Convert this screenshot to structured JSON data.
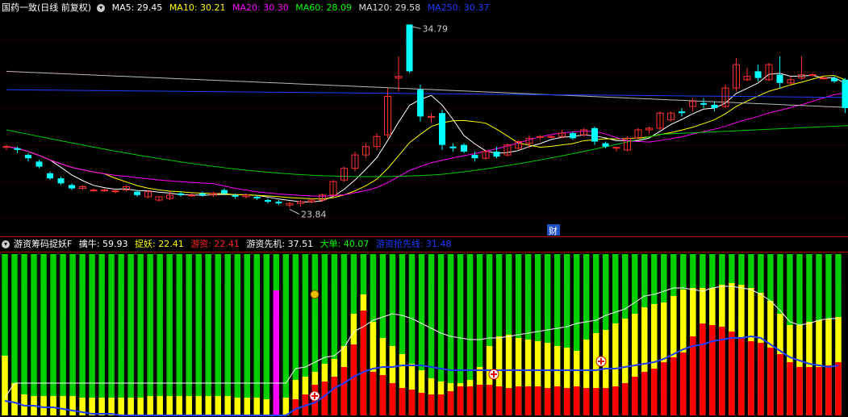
{
  "header": {
    "title": "国药一致(日线 前复权)",
    "ma": [
      {
        "label": "MA5: 29.45",
        "color": "#ffffff"
      },
      {
        "label": "MA10: 30.21",
        "color": "#ffff00"
      },
      {
        "label": "MA20: 30.30",
        "color": "#ff00ff"
      },
      {
        "label": "MA60: 28.09",
        "color": "#00ff00"
      },
      {
        "label": "MA120: 29.58",
        "color": "#dddddd"
      },
      {
        "label": "MA250: 30.37",
        "color": "#1e3cff"
      }
    ]
  },
  "price_annotations": {
    "high": "34.79",
    "low": "23.84",
    "finance_badge": "财"
  },
  "indicator_header": {
    "title": "游资筹码捉妖F",
    "values": [
      {
        "label": "擒牛: 59.93",
        "color": "#ffffff"
      },
      {
        "label": "捉妖: 22.41",
        "color": "#ffff00"
      },
      {
        "label": "游资: 22.41",
        "color": "#ff2020"
      },
      {
        "label": "游资先机: 37.51",
        "color": "#ffffff"
      },
      {
        "label": "大单: 40.07",
        "color": "#00ff00"
      },
      {
        "label": "游资抢先线: 31.48",
        "color": "#1e3cff"
      }
    ]
  },
  "colors": {
    "up": "#ff3030",
    "down": "#00ffff",
    "green_bar": "#00d000",
    "yellow": "#ffff00",
    "red": "#ff0000",
    "magenta": "#ff00ff",
    "blue": "#1e3cff"
  },
  "chart_data": {
    "type": "candlestick",
    "candles": [
      [
        27.5,
        27.6,
        27.3,
        27.5
      ],
      [
        27.4,
        27.5,
        27.1,
        27.3
      ],
      [
        27.0,
        27.1,
        26.6,
        26.8
      ],
      [
        26.6,
        26.7,
        26.2,
        26.3
      ],
      [
        25.9,
        26.0,
        25.5,
        25.6
      ],
      [
        25.6,
        25.7,
        25.2,
        25.3
      ],
      [
        25.2,
        25.3,
        24.9,
        25.0
      ],
      [
        25.0,
        25.2,
        24.9,
        25.1
      ],
      [
        24.9,
        25.0,
        24.8,
        24.9
      ],
      [
        24.9,
        25.0,
        24.8,
        24.9
      ],
      [
        24.8,
        24.9,
        24.7,
        24.85
      ],
      [
        24.9,
        25.2,
        24.8,
        25.1
      ],
      [
        24.8,
        24.9,
        24.5,
        24.6
      ],
      [
        24.5,
        24.9,
        24.4,
        24.8
      ],
      [
        24.3,
        24.5,
        24.2,
        24.5
      ],
      [
        24.4,
        24.8,
        24.3,
        24.6
      ],
      [
        24.7,
        24.8,
        24.5,
        24.6
      ],
      [
        24.6,
        24.7,
        24.5,
        24.6
      ],
      [
        24.7,
        24.8,
        24.5,
        24.6
      ],
      [
        24.6,
        24.8,
        24.5,
        24.7
      ],
      [
        24.9,
        25.0,
        24.6,
        24.7
      ],
      [
        24.6,
        24.7,
        24.4,
        24.5
      ],
      [
        24.5,
        24.7,
        24.4,
        24.6
      ],
      [
        24.5,
        24.6,
        24.3,
        24.4
      ],
      [
        24.3,
        24.4,
        24.1,
        24.2
      ],
      [
        24.2,
        24.3,
        24.0,
        24.1
      ],
      [
        24.0,
        24.2,
        23.84,
        24.1
      ],
      [
        24.1,
        24.3,
        23.9,
        24.2
      ],
      [
        24.2,
        24.4,
        24.1,
        24.3
      ],
      [
        24.3,
        24.7,
        24.2,
        24.6
      ],
      [
        24.6,
        25.5,
        24.5,
        25.4
      ],
      [
        25.5,
        26.3,
        25.4,
        26.2
      ],
      [
        26.2,
        27.2,
        26.0,
        27.0
      ],
      [
        27.0,
        27.7,
        26.8,
        27.5
      ],
      [
        27.5,
        28.3,
        27.3,
        28.1
      ],
      [
        28.2,
        31.0,
        28.0,
        30.5
      ],
      [
        31.6,
        32.9,
        30.8,
        31.7
      ],
      [
        34.8,
        34.79,
        31.9,
        32.0
      ],
      [
        30.9,
        31.2,
        29.0,
        29.3
      ],
      [
        29.3,
        29.5,
        28.9,
        29.3
      ],
      [
        29.5,
        29.7,
        27.3,
        27.6
      ],
      [
        27.5,
        27.7,
        27.2,
        27.4
      ],
      [
        27.6,
        27.7,
        27.1,
        27.2
      ],
      [
        27.0,
        27.2,
        26.6,
        26.8
      ],
      [
        26.8,
        27.3,
        26.7,
        27.2
      ],
      [
        27.2,
        27.5,
        26.8,
        26.9
      ],
      [
        27.0,
        27.7,
        26.9,
        27.6
      ],
      [
        27.4,
        27.9,
        27.3,
        27.8
      ],
      [
        27.7,
        28.2,
        27.4,
        28.0
      ],
      [
        28.1,
        28.2,
        27.9,
        28.1
      ],
      [
        28.1,
        28.2,
        28.0,
        28.1
      ],
      [
        28.1,
        28.5,
        28.0,
        28.3
      ],
      [
        28.3,
        28.4,
        27.9,
        28.0
      ],
      [
        28.2,
        28.6,
        28.1,
        28.5
      ],
      [
        28.6,
        28.7,
        27.6,
        27.8
      ],
      [
        27.7,
        27.8,
        27.4,
        27.5
      ],
      [
        27.4,
        27.5,
        27.2,
        27.45
      ],
      [
        27.3,
        28.1,
        27.2,
        28.0
      ],
      [
        28.0,
        28.6,
        27.9,
        28.5
      ],
      [
        28.5,
        28.7,
        28.3,
        28.6
      ],
      [
        28.6,
        29.6,
        28.5,
        29.5
      ],
      [
        29.1,
        29.6,
        29.0,
        29.5
      ],
      [
        29.6,
        29.8,
        29.3,
        29.5
      ],
      [
        29.9,
        30.4,
        29.6,
        30.2
      ],
      [
        30.1,
        30.4,
        29.8,
        30.0
      ],
      [
        30.0,
        30.2,
        29.6,
        29.8
      ],
      [
        29.9,
        31.2,
        29.8,
        31.0
      ],
      [
        31.0,
        32.8,
        30.8,
        32.4
      ],
      [
        31.5,
        32.2,
        31.4,
        31.7
      ],
      [
        32.0,
        32.4,
        31.4,
        31.6
      ],
      [
        31.5,
        32.5,
        31.4,
        32.4
      ],
      [
        31.8,
        32.9,
        31.0,
        31.3
      ],
      [
        31.3,
        31.7,
        31.2,
        31.5
      ],
      [
        31.6,
        32.9,
        31.5,
        31.8
      ],
      [
        31.8,
        31.9,
        31.7,
        31.8
      ],
      [
        31.6,
        31.7,
        31.5,
        31.6
      ],
      [
        31.6,
        31.7,
        31.3,
        31.4
      ],
      [
        31.5,
        31.6,
        29.5,
        29.8
      ],
      [
        29.6,
        29.7,
        29.2,
        29.4
      ],
      [
        29.3,
        29.4,
        29.1,
        29.2
      ],
      [
        29.1,
        29.4,
        29.0,
        29.3
      ],
      [
        29.2,
        29.5,
        29.1,
        29.4
      ],
      [
        29.4,
        29.6,
        29.3,
        29.4
      ],
      [
        29.4,
        29.5,
        29.3,
        29.4
      ],
      [
        29.4,
        29.6,
        29.3,
        29.5
      ],
      [
        29.6,
        29.9,
        29.4,
        29.5
      ]
    ],
    "indicator": {
      "top_line": [
        11,
        20,
        20,
        20,
        20,
        20,
        20,
        20,
        20,
        20,
        20,
        20,
        20,
        20,
        20,
        20,
        20,
        20,
        20,
        20,
        20,
        20,
        20,
        20,
        20,
        20,
        20,
        20,
        20,
        20,
        29,
        30,
        33,
        36,
        37,
        42,
        52,
        55,
        59,
        61,
        63,
        62,
        60,
        57,
        54,
        51,
        49,
        48,
        47,
        47,
        48,
        48,
        49,
        50,
        51,
        52,
        53,
        54,
        55,
        57,
        58,
        59,
        62,
        64,
        66,
        70,
        74,
        75,
        77,
        79,
        79,
        78,
        77,
        79,
        80,
        80,
        79,
        78,
        75,
        71,
        65,
        58,
        56,
        57,
        59,
        60,
        60
      ],
      "yellow_top": [
        37,
        20,
        13,
        12,
        12,
        12,
        12,
        12,
        11,
        11,
        11,
        11,
        11,
        11,
        11,
        12,
        12,
        12,
        12,
        12,
        12,
        12,
        12,
        12,
        11,
        11,
        11,
        10,
        10,
        11,
        22,
        24,
        27,
        32,
        35,
        43,
        63,
        75,
        58,
        48,
        43,
        38,
        32,
        28,
        23,
        21,
        20,
        20,
        22,
        30,
        43,
        49,
        50,
        48,
        47,
        46,
        45,
        43,
        42,
        40,
        47,
        51,
        53,
        57,
        60,
        63,
        67,
        69,
        70,
        74,
        78,
        79,
        79,
        79,
        81,
        82,
        81,
        79,
        76,
        71,
        63,
        56,
        56,
        58,
        59,
        60,
        61
      ],
      "red_top": [
        0,
        0,
        0,
        0,
        0,
        0,
        0,
        0,
        0,
        0,
        0,
        0,
        0,
        0,
        0,
        0,
        0,
        0,
        0,
        0,
        0,
        0,
        0,
        0,
        0,
        0,
        0,
        0,
        0,
        0,
        10,
        13,
        19,
        21,
        24,
        30,
        44,
        65,
        27,
        25,
        20,
        17,
        16,
        14,
        13,
        13,
        15,
        18,
        18,
        19,
        19,
        18,
        17,
        18,
        18,
        18,
        17,
        18,
        17,
        18,
        17,
        17,
        17,
        18,
        20,
        24,
        27,
        29,
        33,
        36,
        39,
        49,
        57,
        56,
        55,
        52,
        48,
        46,
        45,
        42,
        38,
        33,
        30,
        30,
        30,
        31,
        33
      ],
      "blue": [
        9,
        8,
        6,
        6,
        5,
        5,
        4,
        3,
        2,
        1,
        1,
        1,
        0,
        0,
        0,
        0,
        0,
        0,
        0,
        0,
        0,
        0,
        0,
        0,
        0,
        0,
        0,
        0,
        0,
        0,
        4,
        6,
        8,
        12,
        17,
        20,
        24,
        27,
        29,
        30,
        30,
        31,
        31,
        31,
        30,
        29,
        28,
        28,
        28,
        28,
        28,
        28,
        28,
        28,
        28,
        28,
        28,
        28,
        28,
        28,
        28,
        28,
        29,
        29,
        30,
        31,
        32,
        33,
        35,
        38,
        41,
        43,
        44,
        46,
        47,
        48,
        48,
        49,
        48,
        44,
        40,
        36,
        34,
        32,
        31,
        30,
        31
      ]
    },
    "y_range": [
      23.0,
      35.3
    ],
    "ma_lines": [
      "MA5",
      "MA10",
      "MA20",
      "MA60",
      "MA120",
      "MA250"
    ]
  }
}
